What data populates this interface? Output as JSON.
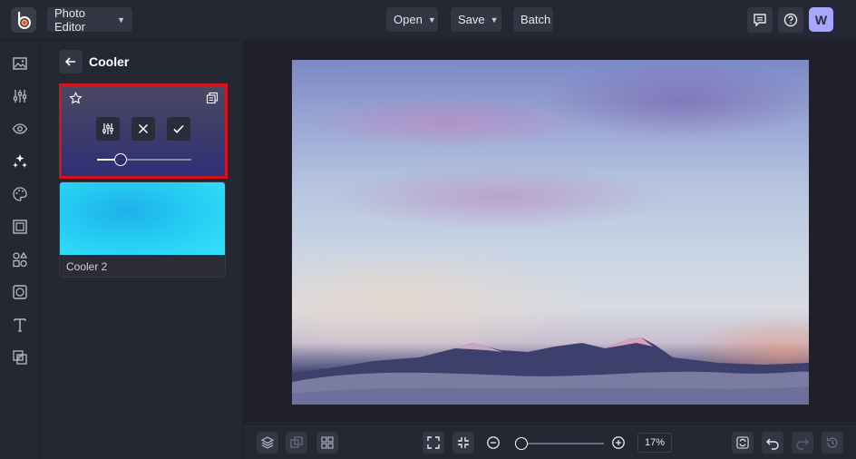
{
  "app": {
    "mode_label": "Photo Editor",
    "avatar_initial": "W",
    "accent": "#a6a8ff"
  },
  "toolbar": {
    "open_label": "Open",
    "save_label": "Save",
    "batch_label": "Batch"
  },
  "panel": {
    "title": "Cooler",
    "active_effect": {
      "intensity": 0.25,
      "highlight_color": "#d3141b"
    },
    "items": [
      {
        "label": "Cooler 2"
      }
    ]
  },
  "left_rail": {
    "icons": [
      "image-icon",
      "adjust-icon",
      "eye-icon",
      "effects-icon",
      "palette-icon",
      "frame-icon",
      "shapes-icon",
      "texture-icon",
      "text-icon",
      "overlay-icon"
    ]
  },
  "bottom": {
    "zoom_percent": "17%",
    "zoom_level": 0.05
  }
}
